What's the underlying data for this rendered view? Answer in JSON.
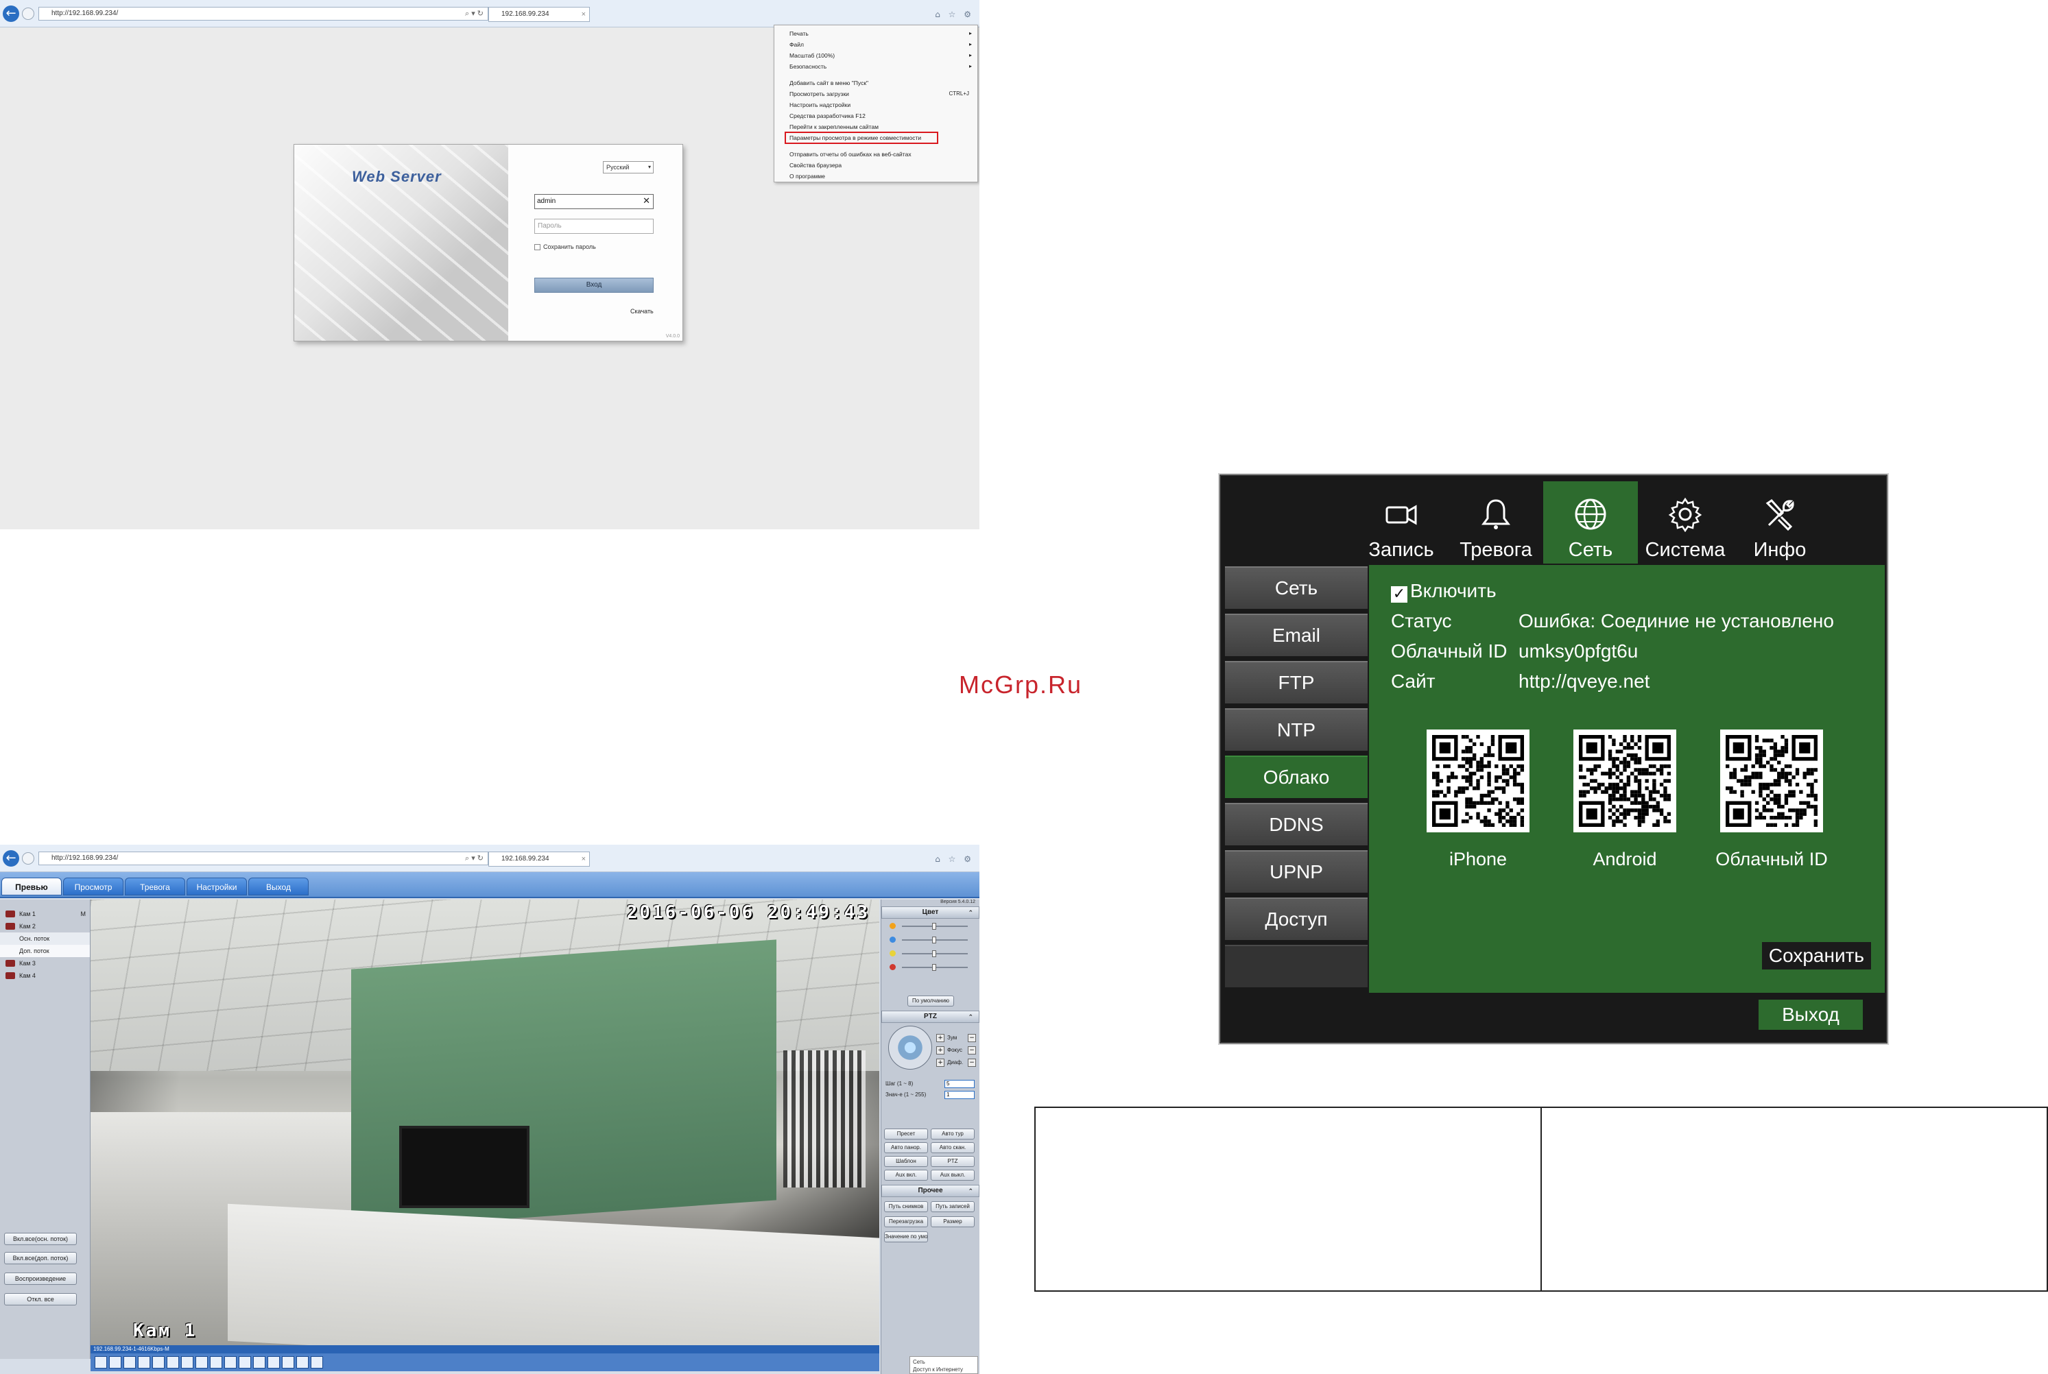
{
  "browser": {
    "address_url": "http://192.168.99.234/",
    "address_tools": "⌕ ▾ ↻",
    "tab_title": "192.168.99.234",
    "tab_close": "×",
    "right_icons": "⌂ ☆ ⚙"
  },
  "context_menu": {
    "items": [
      {
        "label": "Печать",
        "arrow": "▸"
      },
      {
        "label": "Файл",
        "arrow": "▸"
      },
      {
        "label": "Масштаб (100%)",
        "arrow": "▸"
      },
      {
        "label": "Безопасность",
        "arrow": "▸"
      },
      {
        "label": "Добавить сайт в меню \"Пуск\""
      },
      {
        "label": "Просмотреть загрузки",
        "shortcut": "CTRL+J"
      },
      {
        "label": "Настроить надстройки"
      },
      {
        "label": "Средства разработчика F12"
      },
      {
        "label": "Перейти к закрепленным сайтам"
      },
      {
        "label": "Параметры просмотра в режиме совместимости",
        "highlighted": true
      },
      {
        "label": "Отправить отчеты об ошибках на веб-сайтах"
      },
      {
        "label": "Свойства браузера"
      },
      {
        "label": "О программе"
      }
    ]
  },
  "login": {
    "title": "Web Server",
    "language": "Русский",
    "username_value": "admin",
    "password_placeholder": "Пароль",
    "remember_label": "Сохранить пароль",
    "login_button": "Вход",
    "download_link": "Скачать",
    "version": "V4.0.0"
  },
  "camera_ui": {
    "nav": [
      "Превью",
      "Просмотр",
      "Тревога",
      "Настройки",
      "Выход"
    ],
    "cameras": [
      {
        "label": "Кам 1",
        "suffix": "M"
      },
      {
        "label": "Кам 2"
      },
      {
        "label": "Осн. поток",
        "sub": true
      },
      {
        "label": "Доп. поток",
        "sub": true,
        "selected": true
      },
      {
        "label": "Кам 3"
      },
      {
        "label": "Кам 4"
      }
    ],
    "left_buttons": [
      "Вкл.все(осн. поток)",
      "Вкл.все(доп. поток)",
      "Воспроизведение",
      "Откл. все"
    ],
    "osd_time": "2016-06-06 20:49:43",
    "osd_camera": "Кам 1",
    "status_text": "192.168.99.234-1-4616Kbps-M",
    "version": "Версия 5.4.0.12",
    "panels": {
      "color": "Цвет",
      "default_button": "По умолчанию",
      "ptz": "PTZ",
      "zoom": "Зум",
      "focus": "Фокус",
      "iris": "Диаф.",
      "step_label": "Шаг (1 ~ 8)",
      "step_value": "5",
      "value_label": "Знач-е (1 ~ 255)",
      "value_value": "1",
      "ptz_buttons": [
        "Пресет",
        "Авто тур",
        "Авто панор.",
        "Авто скан.",
        "Шаблон",
        "PTZ",
        "Aux вкл.",
        "Aux выкл."
      ],
      "other": "Прочее",
      "other_buttons": [
        "Путь снимков",
        "Путь записей",
        "Перезагрузка",
        "Размер",
        "Значение по умолч."
      ]
    },
    "tray_text": [
      "Сеть",
      "Доступ к Интернету"
    ]
  },
  "watermark": "McGrp.Ru",
  "dvr": {
    "tabs": [
      {
        "label": "Запись",
        "icon": "camera-icon"
      },
      {
        "label": "Тревога",
        "icon": "bell-icon"
      },
      {
        "label": "Сеть",
        "icon": "globe-icon",
        "active": true
      },
      {
        "label": "Система",
        "icon": "gear-icon"
      },
      {
        "label": "Инфо",
        "icon": "tools-icon"
      }
    ],
    "sidebar": [
      {
        "label": "Сеть"
      },
      {
        "label": "Email"
      },
      {
        "label": "FTP"
      },
      {
        "label": "NTP"
      },
      {
        "label": "Облако",
        "active": true
      },
      {
        "label": "DDNS"
      },
      {
        "label": "UPNP"
      },
      {
        "label": "Доступ"
      }
    ],
    "enable_label": "Включить",
    "enable_checked": true,
    "status_label": "Статус",
    "status_value": "Ошибка: Соединие не установлено",
    "cloud_id_label": "Облачный ID",
    "cloud_id_value": "umksy0pfgt6u",
    "site_label": "Сайт",
    "site_value": "http://qveye.net",
    "qr_labels": [
      "iPhone",
      "Android",
      "Облачный ID"
    ],
    "save_button": "Сохранить",
    "exit_button": "Выход"
  },
  "colors": {
    "dvr_green": "#2d6b2e",
    "dvr_dark": "#191919",
    "watermark_red": "#c8242c",
    "highlight_red": "#d9191f",
    "ie_blue": "#2a6ec2"
  }
}
